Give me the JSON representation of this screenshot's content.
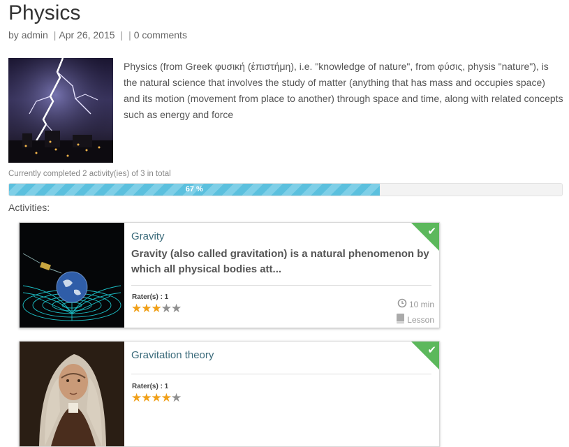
{
  "post": {
    "title": "Physics",
    "meta": {
      "by_prefix": "by",
      "author": "admin",
      "separator": "|",
      "date": "Apr 26, 2015",
      "comments": "0 comments"
    },
    "description": "Physics (from Greek φυσική (ἐπιστήμη), i.e. \"knowledge of nature\", from φύσις, physis \"nature\"), is the natural science that involves the study of matter (anything that has mass and occupies space) and its motion (movement from place to another) through space and time, along with related concepts such as energy and force"
  },
  "progress": {
    "caption": "Currently completed 2 activity(ies) of 3 in total",
    "percent": 67,
    "label": "67 %",
    "fill_color": "#5bc0de"
  },
  "activities_label": "Activities:",
  "activities": [
    {
      "title": "Gravity",
      "excerpt": "Gravity (also called gravitation) is a natural phenomenon by which all physical bodies att...",
      "rater_label": "Rater(s) : 1",
      "rating": 3,
      "rating_max": 5,
      "duration": "10 min",
      "type": "Lesson",
      "completed": true,
      "thumb_icon": "earth-spacetime-image"
    },
    {
      "title": "Gravitation theory",
      "excerpt": "",
      "rater_label": "Rater(s) : 1",
      "rating": 4,
      "rating_max": 5,
      "completed": true,
      "thumb_icon": "newton-portrait-image"
    }
  ],
  "colors": {
    "accent": "#5cb85c",
    "star": "#f0a019",
    "link": "#3a6a7a"
  }
}
